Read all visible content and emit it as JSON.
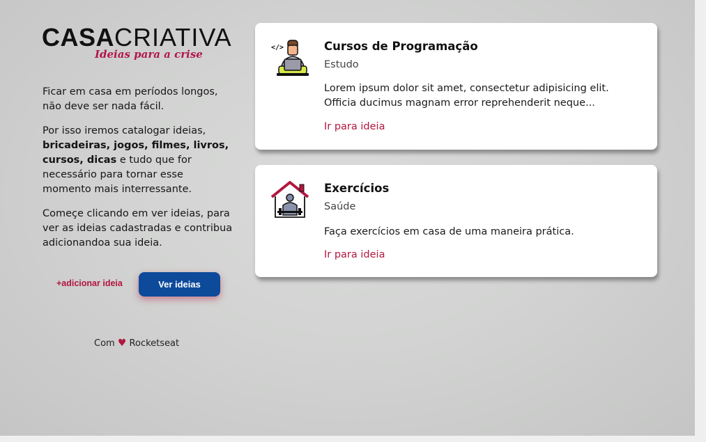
{
  "brand": {
    "name_bold": "CASA",
    "name_light": "CRIATIVA",
    "tagline": "Ideias para a crise"
  },
  "intro": {
    "p1": "Ficar em casa em períodos longos, não deve ser nada fácil.",
    "p2_before": "Por isso iremos catalogar ideias, ",
    "p2_bold": "bricadeiras, jogos, filmes, livros, cursos, dicas",
    "p2_after": " e tudo que for necessário para tornar esse momento mais interressante.",
    "p3": "Começe clicando em ver ideias, para ver as ideias cadastradas e contribua adicionandoa sua ideia."
  },
  "actions": {
    "add_label": "+adicionar ideia",
    "view_label": "Ver ideias"
  },
  "footer": {
    "prefix": "Com",
    "suffix": "Rocketseat"
  },
  "ideas": [
    {
      "title": "Cursos de Programação",
      "category": "Estudo",
      "description": "Lorem ipsum dolor sit amet, consectetur adipisicing elit. Officia ducimus magnam error reprehenderit neque...",
      "link": "Ir para ideia",
      "icon": "programmer-icon"
    },
    {
      "title": "Exercícios",
      "category": "Saúde",
      "description": "Faça exercícios em casa de uma maneira prática.",
      "link": "Ir para ideia",
      "icon": "home-exercise-icon"
    }
  ],
  "colors": {
    "accent": "#b2163f",
    "button": "#0d4a9a",
    "background": "#d2d3d2"
  }
}
